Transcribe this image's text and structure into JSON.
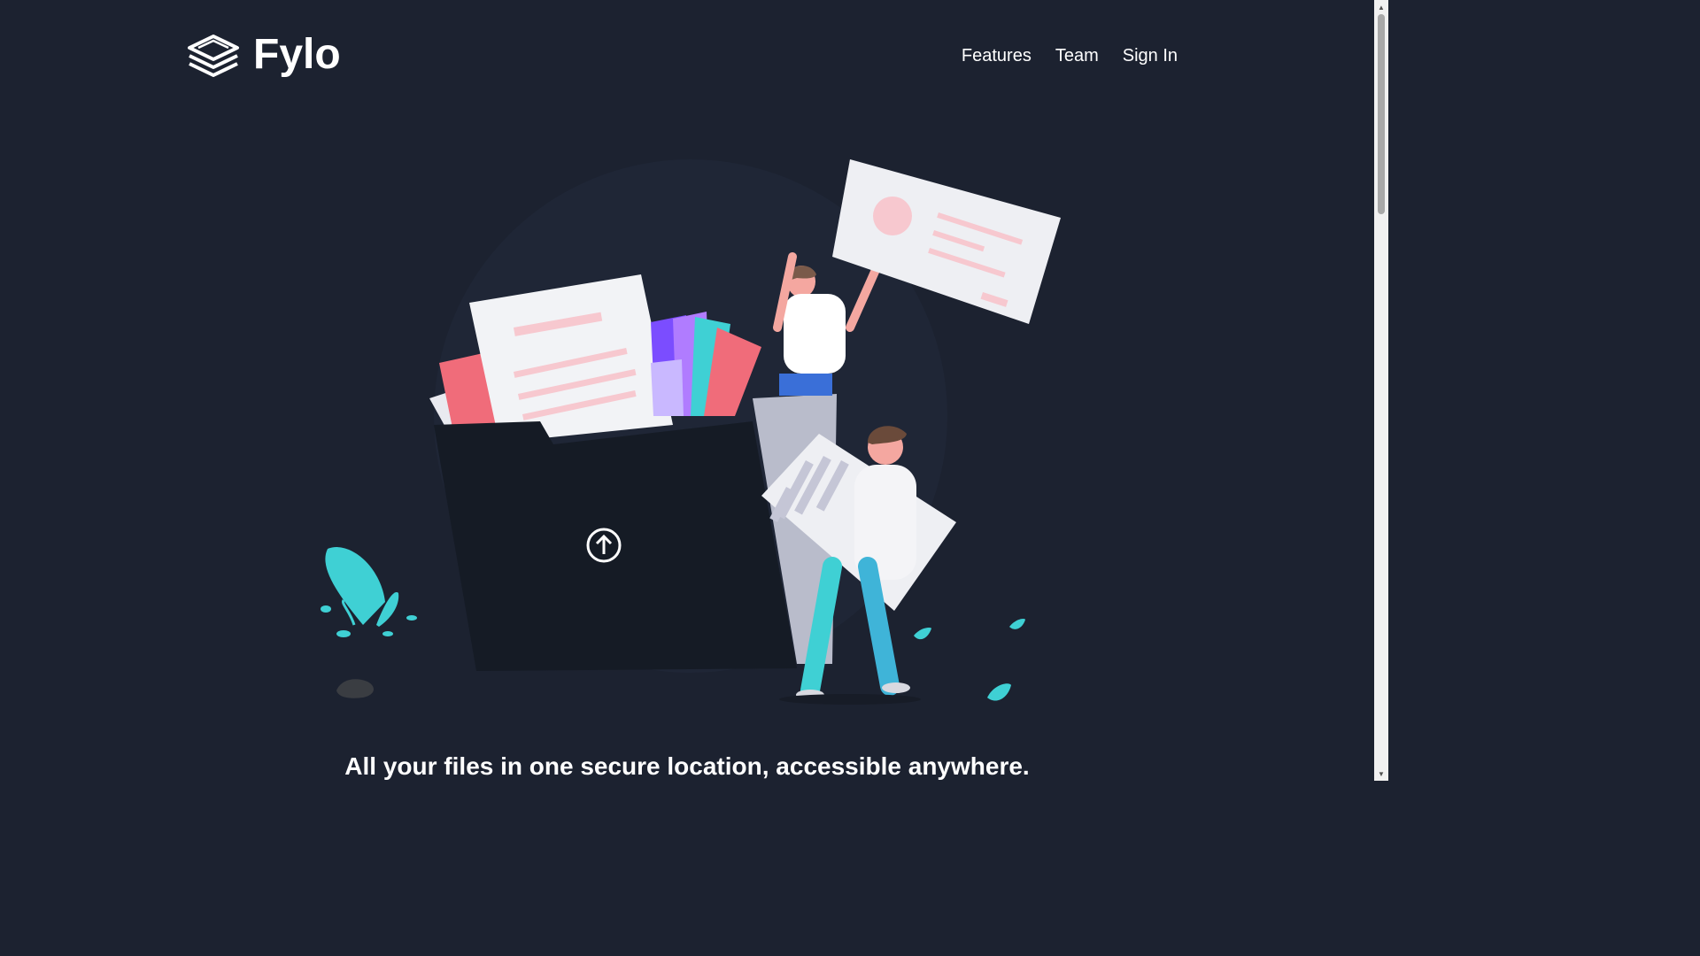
{
  "brand": {
    "name": "Fylo",
    "logo_icon": "stacked-layers-icon"
  },
  "nav": {
    "items": [
      {
        "label": "Features"
      },
      {
        "label": "Team"
      },
      {
        "label": "Sign In"
      }
    ]
  },
  "hero": {
    "illustration": "files-folder-illustration",
    "upload_icon": "arrow-up-circle-icon",
    "headline": "All your files in one secure location, accessible anywhere."
  },
  "colors": {
    "background": "#1c2230",
    "text": "#ffffff",
    "accent_cyan": "#3fd0d4",
    "accent_pink": "#f06c7a"
  }
}
